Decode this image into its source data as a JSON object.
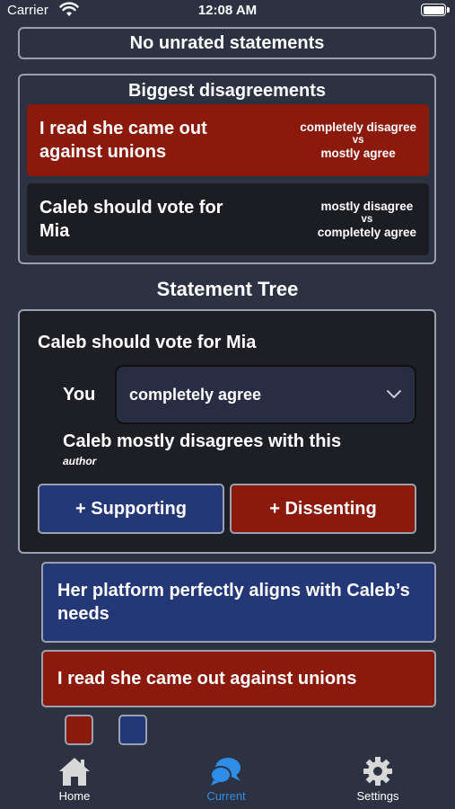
{
  "status_bar": {
    "carrier": "Carrier",
    "time": "12:08 AM"
  },
  "unrated": {
    "label": "No unrated statements"
  },
  "disagreements": {
    "title": "Biggest disagreements",
    "items": [
      {
        "statement": "I read she came out against unions",
        "rating_a": "completely disagree",
        "vs": "vs",
        "rating_b": "mostly agree",
        "color": "#8b1a0d"
      },
      {
        "statement": "Caleb should vote for Mia",
        "rating_a": "mostly disagree",
        "vs": "vs",
        "rating_b": "completely agree",
        "color": "#1c1d22"
      }
    ]
  },
  "tree": {
    "title": "Statement Tree",
    "statement": "Caleb should vote for Mia",
    "you_label": "You",
    "your_rating": "completely agree",
    "author_line": "Caleb mostly disagrees with this",
    "author_tag": "author",
    "supporting_label": "+ Supporting",
    "dissenting_label": "+ Dissenting"
  },
  "children": [
    {
      "text": "Her platform perfectly aligns with Caleb’s needs",
      "kind": "supporting",
      "color": "#243777"
    },
    {
      "text": "I read she came out against unions",
      "kind": "dissenting",
      "color": "#8b1a0d"
    }
  ],
  "legend_swatches": [
    {
      "icon": "dissenting-swatch",
      "color": "#8b1a0d"
    },
    {
      "icon": "supporting-swatch",
      "color": "#243777"
    }
  ],
  "tabbar": {
    "tabs": [
      {
        "label": "Home",
        "icon": "home-icon",
        "active": false
      },
      {
        "label": "Current",
        "icon": "chat-bubbles-icon",
        "active": true
      },
      {
        "label": "Settings",
        "icon": "gear-icon",
        "active": false
      }
    ],
    "active_color": "#2e8de6"
  }
}
